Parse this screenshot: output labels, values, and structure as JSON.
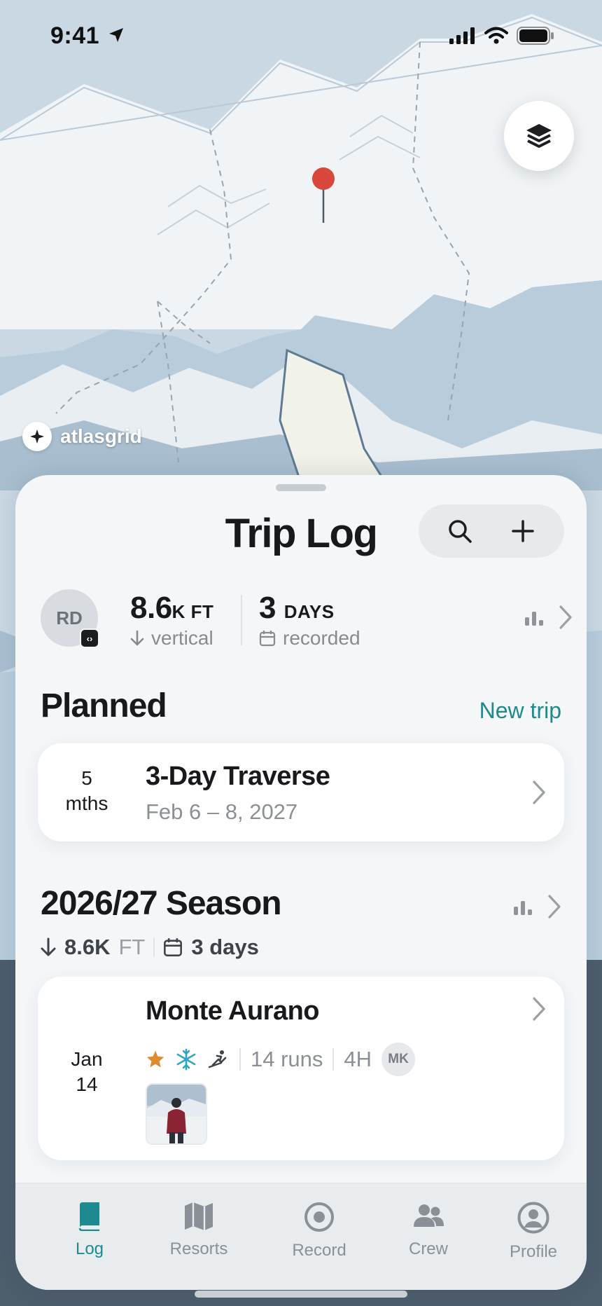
{
  "status_bar": {
    "time": "9:41"
  },
  "map": {
    "brand": "atlasgrid"
  },
  "sheet": {
    "title": "Trip Log",
    "avatar_initials": "RD",
    "stats": {
      "vertical_value": "8.6",
      "vertical_unit": "K FT",
      "vertical_label": "vertical",
      "days_value": "3",
      "days_unit": "DAYS",
      "days_label": "recorded"
    },
    "planned": {
      "heading": "Planned",
      "new_trip_label": "New trip",
      "trip": {
        "countdown_number": "5",
        "countdown_unit": "mths",
        "title": "3-Day Traverse",
        "dates": "Feb 6 – 8, 2027"
      }
    },
    "season": {
      "heading": "2026/27 Season",
      "vertical": "8.6K",
      "vertical_unit": "FT",
      "days": "3 days",
      "trip": {
        "month": "Jan",
        "day": "14",
        "title": "Monte Aurano",
        "runs": "14 runs",
        "duration": "4H",
        "crew_initials": "MK"
      }
    }
  },
  "tabbar": {
    "tabs": [
      {
        "label": "Log",
        "active": true
      },
      {
        "label": "Resorts"
      },
      {
        "label": "Record"
      },
      {
        "label": "Crew"
      },
      {
        "label": "Profile"
      }
    ]
  },
  "colors": {
    "accent": "#1c8a8f",
    "pin": "#d9463b",
    "star": "#e08a2e",
    "snow": "#2fa6c2"
  }
}
